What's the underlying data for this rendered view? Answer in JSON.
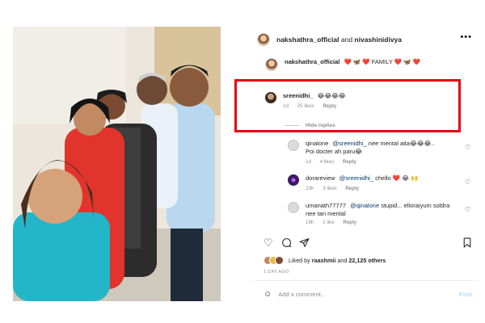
{
  "post": {
    "owner": "nakshathra_official",
    "and": "and",
    "collaborator": "nivashinidivya",
    "more_icon": "more-horizontal-icon",
    "caption_user": "nakshathra_official",
    "caption_text": "❤️ 🦋 ❤️ FAMILY ❤️ 🦋 ❤️"
  },
  "comments": [
    {
      "user": "sreenidhi_",
      "text": "😂😂😂😂",
      "time": "1d",
      "likes": "25 likes",
      "reply": "Reply",
      "highlighted": true
    }
  ],
  "hide_replies": "Hide replies",
  "replies": [
    {
      "user": "qinalone",
      "mention": "@sreenidhi_",
      "text": "nee mental aita😂😂😂..",
      "text2": "Poi docter ah paru😂",
      "time": "1d",
      "likes": "4 likes",
      "reply": "Reply"
    },
    {
      "user": "dorareview",
      "mention": "@sreenidhi_",
      "text": "chello ❤️ 😂 🙌",
      "time": "23h",
      "likes": "3 likes",
      "reply": "Reply"
    },
    {
      "user": "umanath77777",
      "mention": "@qinalone",
      "text": "stupid... elloraiyum soldra",
      "text2": "nee tan mental",
      "time": "19h",
      "likes": "1 like",
      "reply": "Reply"
    }
  ],
  "actions": {
    "like_icon": "heart-icon",
    "comment_icon": "comment-icon",
    "share_icon": "send-icon",
    "save_icon": "bookmark-icon"
  },
  "likes": {
    "prefix": "Liked by",
    "user": "raashmii",
    "and": "and",
    "others": "22,125 others"
  },
  "post_date": "1 DAY AGO",
  "add_comment": {
    "emoji_icon": "smiley-icon",
    "placeholder": "Add a comment...",
    "post_label": "Post"
  },
  "colors": {
    "highlight_border": "#e60012",
    "mention": "#00376b",
    "secondary_text": "#8e8e8e",
    "post_button": "#b2dffc"
  }
}
